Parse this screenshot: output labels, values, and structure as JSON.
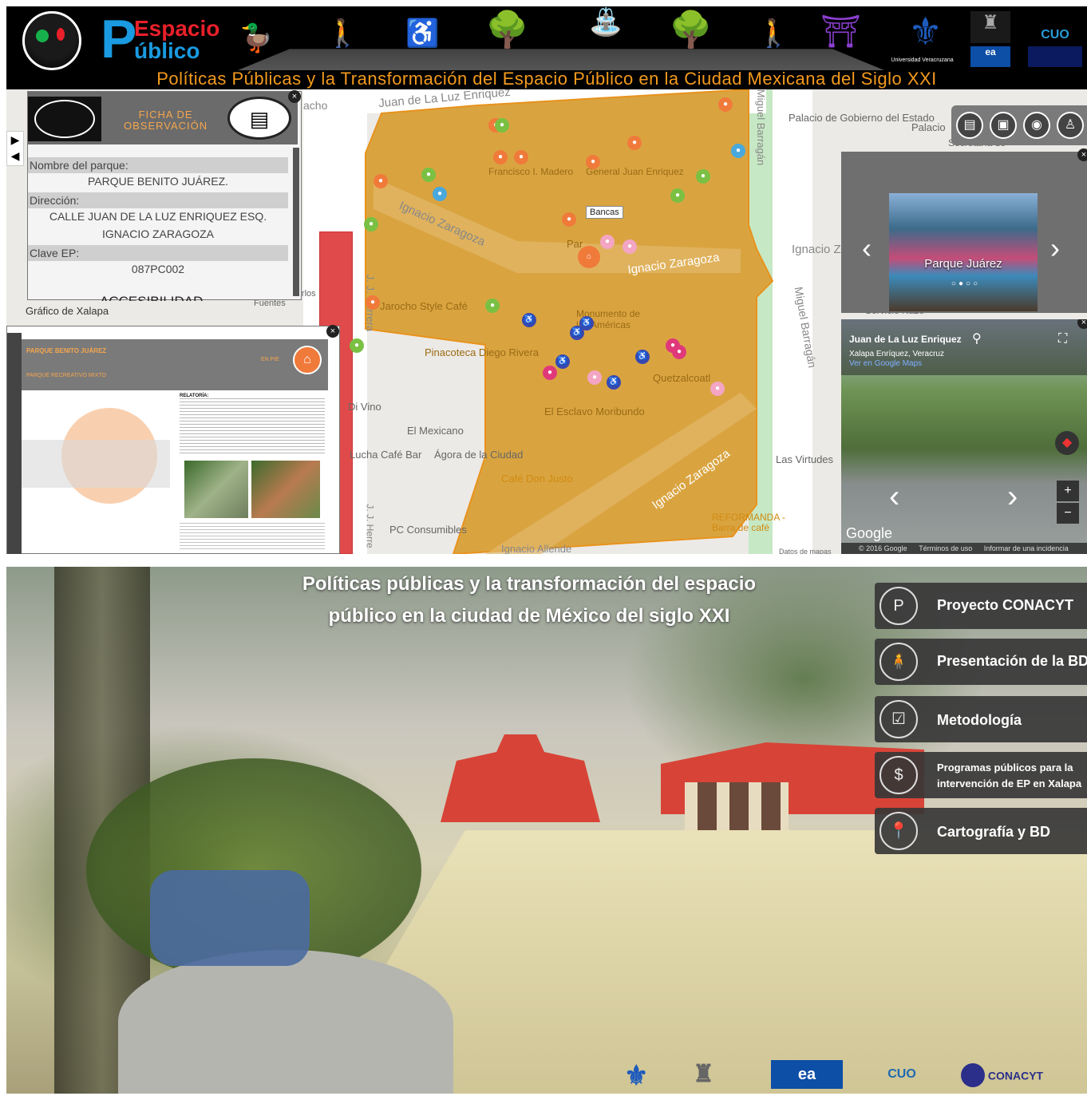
{
  "header": {
    "brand_line1": "Espacio",
    "brand_p": "P",
    "brand_line2": "úblico",
    "title": "Políticas Públicas y la Transformación del Espacio Público en la Ciudad Mexicana del Siglo XXI",
    "uv_caption": "Universidad Veracruzana",
    "cuo": "CUO",
    "ea": "ea"
  },
  "map": {
    "streets": [
      "Juan de La Luz Enriquez",
      "Ignacio Zaragoza",
      "Ignacio Zaragoza",
      "Ignacio Zaragoza",
      "Miguel Barragán",
      "Miguel Barragán",
      "J. J. Herrera",
      "Ignacio Allende",
      "Ignacio Z",
      "acho",
      "J. J. Herre"
    ],
    "places": [
      "Palacio de Gobierno del Estado",
      "Palacio",
      "Secretaría de",
      "Francisco I. Madero",
      "General Juan Enriquez",
      "Bancas",
      "Par",
      "Jarocho Style Café",
      "Monumento de las Américas",
      "Pinacoteca Diego Rivera",
      "Quetzalcoatl",
      "El Esclavo Moribundo",
      "El Mexicano",
      "Ágora de la Ciudad",
      "Café Don Justo",
      "Las Virtudes",
      "PC Consumibles",
      "REFORMANDA - Barra de café",
      "Lucha Café Bar",
      "Di Vino",
      "Pinoteca Carlos Fuentes",
      "Gráfico de Xalapa",
      "Servicio Nazo",
      "Datos de mapas"
    ],
    "tooltip": "Bancas"
  },
  "ficha": {
    "title_line1": "FICHA DE",
    "title_line2": "OBSERVACIÓN",
    "nombre_label": "Nombre del parque:",
    "nombre_value": "PARQUE BENITO JUÁREZ.",
    "direccion_label": "Dirección:",
    "direccion_value_1": "CALLE JUAN DE LA LUZ ENRIQUEZ ESQ.",
    "direccion_value_2": "IGNACIO ZARAGOZA",
    "clave_label": "Clave EP:",
    "clave_value": "087PC002",
    "accesibilidad": "ACCESIBILIDAD"
  },
  "doc_panel": {
    "heading": "PARQUE BENITO JUÁREZ",
    "sub": "PARQUE RECREATIVO MIXTO",
    "tag": "EN PIE",
    "right_heading": "RELATORÍA:"
  },
  "gallery": {
    "caption": "Parque Juárez",
    "prev": "‹",
    "next": "›"
  },
  "streetview": {
    "title": "Juan de La Luz Enriquez",
    "subtitle": "Xalapa Enríquez, Veracruz",
    "link": "Ver en Google Maps",
    "google": "Google",
    "footer_1": "© 2016 Google",
    "footer_2": "Términos de uso",
    "footer_3": "Informar de una incidencia",
    "zoom_in": "+",
    "zoom_out": "−"
  },
  "bottom": {
    "title_line1": "Políticas públicas y la transformación del espacio",
    "title_line2": "público en la ciudad de México del siglo XXI",
    "menu": [
      {
        "label": "Proyecto CONACYT",
        "icon": "P"
      },
      {
        "label": "Presentación de la BD",
        "icon": "🧍"
      },
      {
        "label": "Metodología",
        "icon": "☑"
      },
      {
        "label_1": "Programas públicos para la",
        "label_2": "intervención de EP en Xalapa",
        "icon": "$"
      },
      {
        "label": "Cartografía y BD",
        "icon": "📍"
      }
    ],
    "logos": {
      "ea": "ea",
      "cuo": "CUO",
      "conacyt": "CONACYT"
    }
  },
  "colors": {
    "park_fill": "#d9a440",
    "accent_orange": "#f39a1e",
    "brand_blue": "#1a9ae0",
    "brand_red": "#e8202a"
  }
}
